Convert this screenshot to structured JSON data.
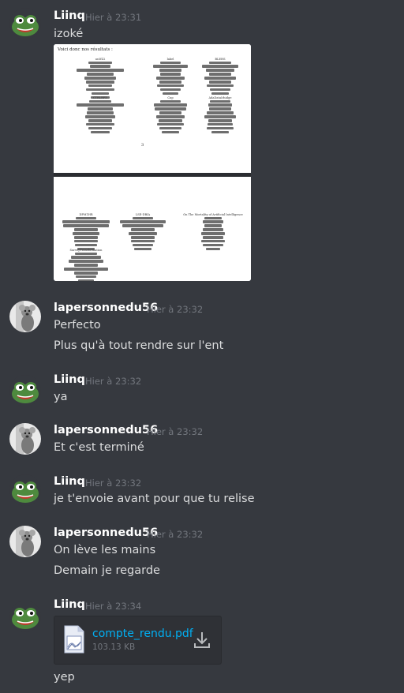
{
  "colors": {
    "background": "#36393f",
    "text": "#dcddde",
    "timestamp": "#72767d",
    "link": "#00b0f4"
  },
  "messages": [
    {
      "author": "Liinq",
      "time": "Hier à 23:31",
      "lines": [
        "izoké"
      ]
    },
    {
      "author": "lapersonnedu56",
      "time": "Hier à 23:32",
      "lines": [
        "Perfecto",
        "Plus qu'à tout rendre sur l'ent"
      ]
    },
    {
      "author": "Liinq",
      "time": "Hier à 23:32",
      "lines": [
        "ya"
      ]
    },
    {
      "author": "lapersonnedu56",
      "time": "Hier à 23:32",
      "lines": [
        "Et c'est terminé"
      ]
    },
    {
      "author": "Liinq",
      "time": "Hier à 23:32",
      "lines": [
        "je t'envoie avant pour que tu relise"
      ]
    },
    {
      "author": "lapersonnedu56",
      "time": "Hier à 23:32",
      "lines": [
        "On lève les mains",
        "Demain je regarde"
      ]
    },
    {
      "author": "Liinq",
      "time": "Hier à 23:34",
      "lines": [
        "yep"
      ]
    }
  ],
  "document_preview": {
    "heading": "Voici donc nos résultats :",
    "page_number": "3",
    "titles": [
      "ue3fZ2",
      "label",
      "BLEHS",
      "CTRLRFD",
      "Cup",
      "AdaDataIrhidge",
      "DPM1HR",
      "LSE-DBIA",
      "On The Mortality of Artificial Intelligence",
      "SurveyTransformation"
    ]
  },
  "attachment": {
    "file_name": "compte_rendu.pdf",
    "file_size": "103.13 KB",
    "icon": "pdf-file-icon",
    "download_icon": "download-icon"
  }
}
